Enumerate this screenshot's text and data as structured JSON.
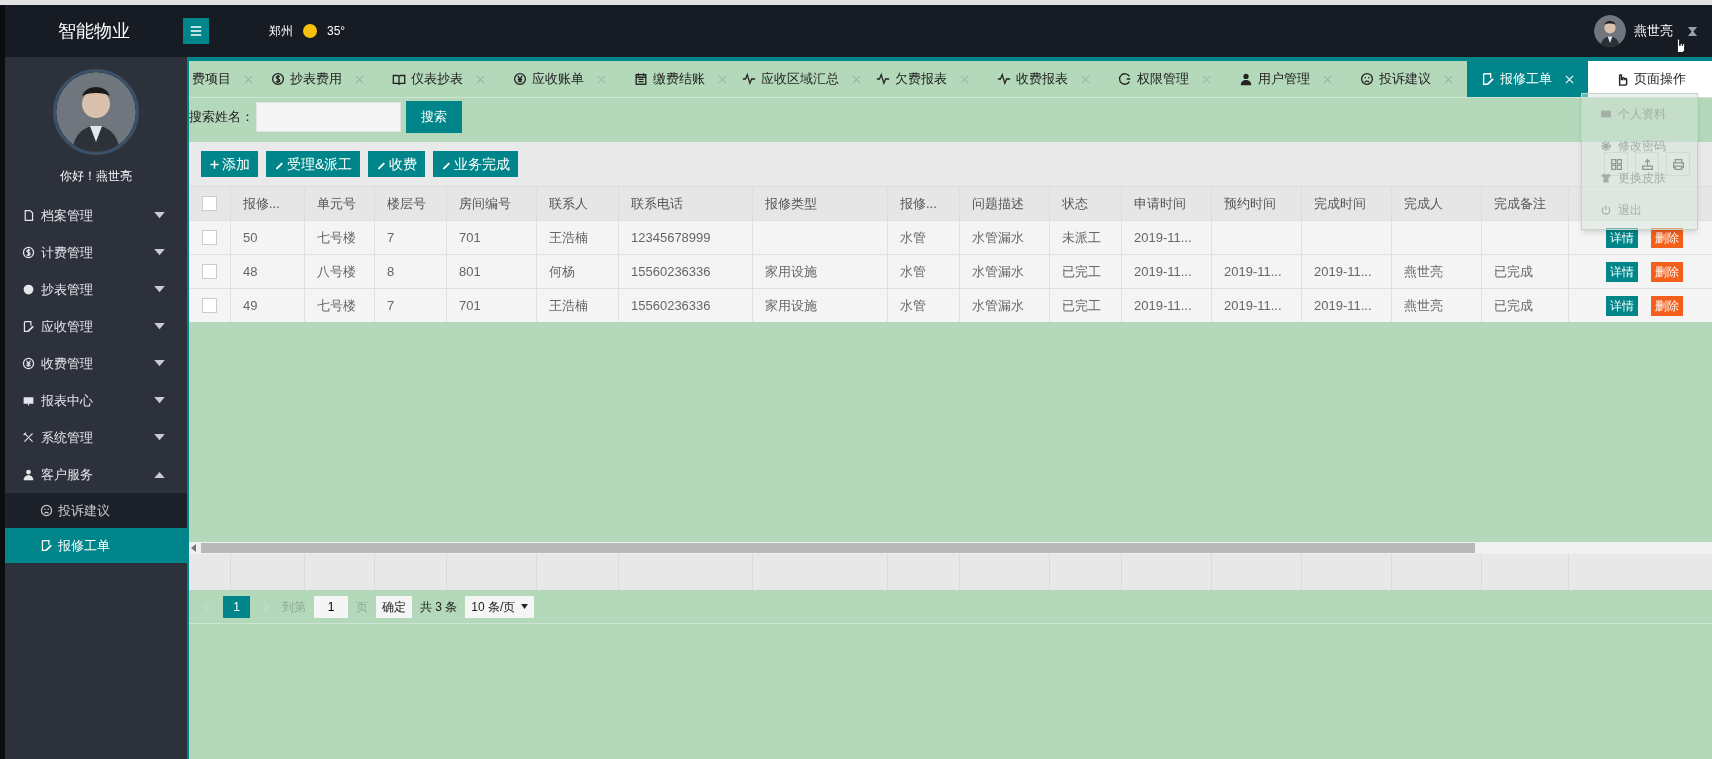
{
  "header": {
    "brand": "智能物业",
    "city": "郑州",
    "temperature": "35°",
    "user_name": "燕世亮"
  },
  "sidebar": {
    "greeting": "你好！燕世亮",
    "menu": [
      {
        "label": "档案管理",
        "expanded": false
      },
      {
        "label": "计费管理",
        "expanded": false
      },
      {
        "label": "抄表管理",
        "expanded": false
      },
      {
        "label": "应收管理",
        "expanded": false
      },
      {
        "label": "收费管理",
        "expanded": false
      },
      {
        "label": "报表中心",
        "expanded": false
      },
      {
        "label": "系统管理",
        "expanded": false
      },
      {
        "label": "客户服务",
        "expanded": true,
        "children": [
          {
            "label": "投诉建议",
            "selected": false
          },
          {
            "label": "报修工单",
            "selected": true
          }
        ]
      }
    ]
  },
  "tabs": [
    {
      "label": "费项目",
      "selected": false
    },
    {
      "label": "抄表费用",
      "selected": false
    },
    {
      "label": "仪表抄表",
      "selected": false
    },
    {
      "label": "应收账单",
      "selected": false
    },
    {
      "label": "缴费结账",
      "selected": false
    },
    {
      "label": "应收区域汇总",
      "selected": false
    },
    {
      "label": "欠费报表",
      "selected": false
    },
    {
      "label": "收费报表",
      "selected": false
    },
    {
      "label": "权限管理",
      "selected": false
    },
    {
      "label": "用户管理",
      "selected": false
    },
    {
      "label": "投诉建议",
      "selected": false
    },
    {
      "label": "报修工单",
      "selected": true
    }
  ],
  "page_ops_button": "页面操作",
  "user_menu": {
    "items": [
      "个人资料",
      "修改密码",
      "更换皮肤",
      "退出"
    ]
  },
  "search": {
    "label": "搜索姓名：",
    "button": "搜索"
  },
  "toolbar": [
    {
      "label": "添加",
      "kind": "add"
    },
    {
      "label": "受理&派工",
      "kind": "edit"
    },
    {
      "label": "收费",
      "kind": "edit"
    },
    {
      "label": "业务完成",
      "kind": "edit"
    }
  ],
  "table": {
    "select_all_checked": false,
    "columns": [
      "报修...",
      "单元号",
      "楼层号",
      "房间编号",
      "联系人",
      "联系电话",
      "报修类型",
      "报修...",
      "问题描述",
      "状态",
      "申请时间",
      "预约时间",
      "完成时间",
      "完成人",
      "完成备注"
    ],
    "rows": [
      {
        "checked": false,
        "cells": [
          "50",
          "七号楼",
          "7",
          "701",
          "王浩楠",
          "12345678999",
          "",
          "水管",
          "水管漏水",
          "未派工",
          "2019-11...",
          "",
          "",
          "",
          ""
        ],
        "actions": [
          "详情",
          "删除"
        ]
      },
      {
        "checked": false,
        "cells": [
          "48",
          "八号楼",
          "8",
          "801",
          "何杨",
          "15560236336",
          "家用设施",
          "水管",
          "水管漏水",
          "已完工",
          "2019-11...",
          "2019-11...",
          "2019-11...",
          "燕世亮",
          "已完成"
        ],
        "actions": [
          "详情",
          "删除"
        ]
      },
      {
        "checked": false,
        "cells": [
          "49",
          "七号楼",
          "7",
          "701",
          "王浩楠",
          "15560236336",
          "家用设施",
          "水管",
          "水管漏水",
          "已完工",
          "2019-11...",
          "2019-11...",
          "2019-11...",
          "燕世亮",
          "已完成"
        ],
        "actions": [
          "详情",
          "删除"
        ]
      }
    ]
  },
  "pagination": {
    "page": "1",
    "goto_label": "到第",
    "page_input": "1",
    "page_unit": "页",
    "confirm": "确定",
    "total": "共 3 条",
    "page_size": "10 条/页"
  }
}
